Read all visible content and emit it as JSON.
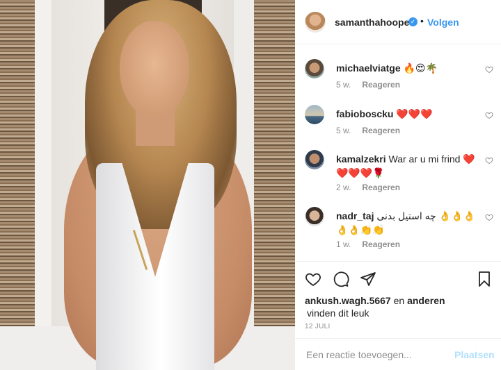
{
  "post": {
    "username": "samanthahoopes",
    "verified_glyph": "✓",
    "separator": "•",
    "follow_label": "Volgen"
  },
  "comments": [
    {
      "user": "michaelviatge",
      "text": " 🔥😍🌴",
      "time": "5 w.",
      "reply": "Reageren"
    },
    {
      "user": "fabioboscku",
      "text": " ❤️❤️❤️",
      "time": "5 w.",
      "reply": "Reageren"
    },
    {
      "user": "kamalzekri",
      "text": " War ar u mi frind ❤️❤️❤️❤️🌹",
      "time": "2 w.",
      "reply": "Reageren"
    },
    {
      "user": "nadr_taj",
      "text": " چه استیل بدنی 👌👌👌👌👌👏👏",
      "time": "1 w.",
      "reply": "Reageren"
    }
  ],
  "icons": {
    "like": "heart-icon",
    "comment": "comment-icon",
    "share": "share-icon",
    "save": "bookmark-icon"
  },
  "likes": {
    "user": "ankush.wagh.5667",
    "connector": " en ",
    "others": "anderen",
    "suffix": "vinden dit leuk"
  },
  "date": "12 JULI",
  "comment_input": {
    "placeholder": "Een reactie toevoegen...",
    "submit_label": "Plaatsen"
  },
  "colors": {
    "accent": "#3897f0",
    "post_disabled": "#b2dffc",
    "muted": "#8e8e8e"
  }
}
